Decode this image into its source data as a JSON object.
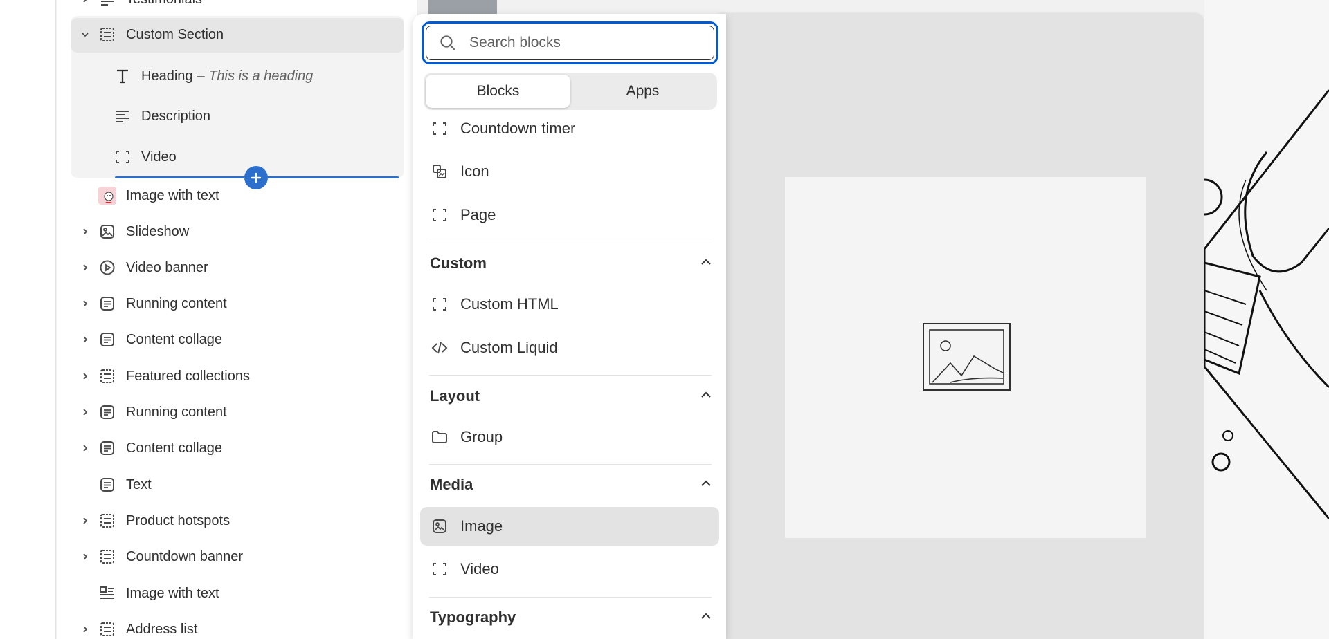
{
  "tree": {
    "items": [
      {
        "label": "Testimonials"
      },
      {
        "label": "Custom Section"
      },
      {
        "label": "Heading",
        "suffix": "– This is a heading"
      },
      {
        "label": "Description"
      },
      {
        "label": "Video"
      },
      {
        "label": "Image with text"
      },
      {
        "label": "Slideshow"
      },
      {
        "label": "Video banner"
      },
      {
        "label": "Running content"
      },
      {
        "label": "Content collage"
      },
      {
        "label": "Featured collections"
      },
      {
        "label": "Running content"
      },
      {
        "label": "Content collage"
      },
      {
        "label": "Text"
      },
      {
        "label": "Product hotspots"
      },
      {
        "label": "Countdown banner"
      },
      {
        "label": "Image with text"
      },
      {
        "label": "Address list"
      }
    ]
  },
  "picker": {
    "search_placeholder": "Search blocks",
    "tabs": [
      {
        "label": "Blocks"
      },
      {
        "label": "Apps"
      }
    ],
    "top_items": [
      {
        "label": "Countdown timer"
      },
      {
        "label": "Icon"
      },
      {
        "label": "Page"
      }
    ],
    "categories": [
      {
        "label": "Custom",
        "items": [
          {
            "label": "Custom HTML"
          },
          {
            "label": "Custom Liquid"
          }
        ]
      },
      {
        "label": "Layout",
        "items": [
          {
            "label": "Group"
          }
        ]
      },
      {
        "label": "Media",
        "items": [
          {
            "label": "Image"
          },
          {
            "label": "Video"
          }
        ]
      },
      {
        "label": "Typography",
        "items": []
      }
    ]
  },
  "colors": {
    "accent": "#005bd3",
    "insert_line": "#2c6ecb",
    "selected_bg": "#e3e3e3"
  }
}
